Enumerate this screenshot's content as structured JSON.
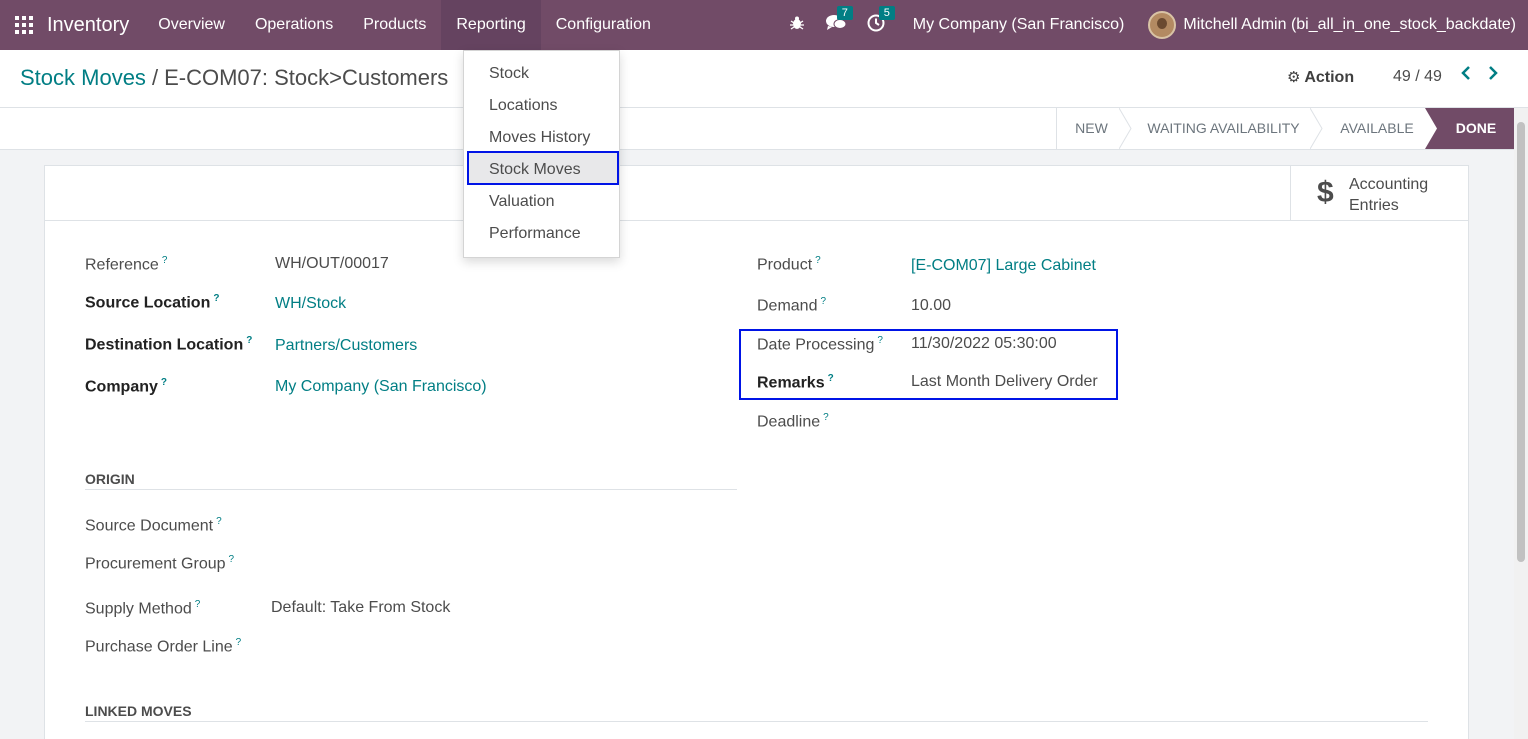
{
  "navbar": {
    "app_name": "Inventory",
    "menu": [
      "Overview",
      "Operations",
      "Products",
      "Reporting",
      "Configuration"
    ],
    "active_menu": "Reporting",
    "messages_count": "7",
    "activities_count": "5",
    "company": "My Company (San Francisco)",
    "user": "Mitchell Admin (bi_all_in_one_stock_backdate)"
  },
  "breadcrumb": {
    "parent": "Stock Moves",
    "separator": "/",
    "current": "E-COM07: Stock>Customers"
  },
  "control": {
    "action_label": "Action",
    "pager": "49 / 49"
  },
  "reporting_menu": {
    "items": [
      "Stock",
      "Locations",
      "Moves History",
      "Stock Moves",
      "Valuation",
      "Performance"
    ],
    "selected": "Stock Moves"
  },
  "statusbar": {
    "stages": [
      "NEW",
      "WAITING AVAILABILITY",
      "AVAILABLE",
      "DONE"
    ],
    "current": "DONE"
  },
  "smart_button": {
    "line1": "Accounting",
    "line2": "Entries",
    "icon": "dollar-icon"
  },
  "form": {
    "reference": {
      "label": "Reference",
      "value": "WH/OUT/00017"
    },
    "source_location": {
      "label": "Source Location",
      "value": "WH/Stock"
    },
    "destination_location": {
      "label": "Destination Location",
      "value": "Partners/Customers"
    },
    "company": {
      "label": "Company",
      "value": "My Company (San Francisco)"
    },
    "product": {
      "label": "Product",
      "value": "[E-COM07] Large Cabinet"
    },
    "demand": {
      "label": "Demand",
      "value": "10.00"
    },
    "date_processing": {
      "label": "Date Processing",
      "value": "11/30/2022 05:30:00"
    },
    "remarks": {
      "label": "Remarks",
      "value": "Last Month Delivery Order"
    },
    "deadline": {
      "label": "Deadline",
      "value": ""
    },
    "help_mark": "?"
  },
  "origin": {
    "title": "ORIGIN",
    "source_document": {
      "label": "Source Document",
      "value": ""
    },
    "procurement_group": {
      "label": "Procurement Group",
      "value": ""
    },
    "supply_method": {
      "label": "Supply Method",
      "value": "Default: Take From Stock"
    },
    "purchase_order_line": {
      "label": "Purchase Order Line",
      "value": ""
    }
  },
  "linked_moves": {
    "title": "LINKED MOVES"
  },
  "colors": {
    "brand": "#714b67",
    "link": "#017e84",
    "highlight": "#0014e6"
  }
}
